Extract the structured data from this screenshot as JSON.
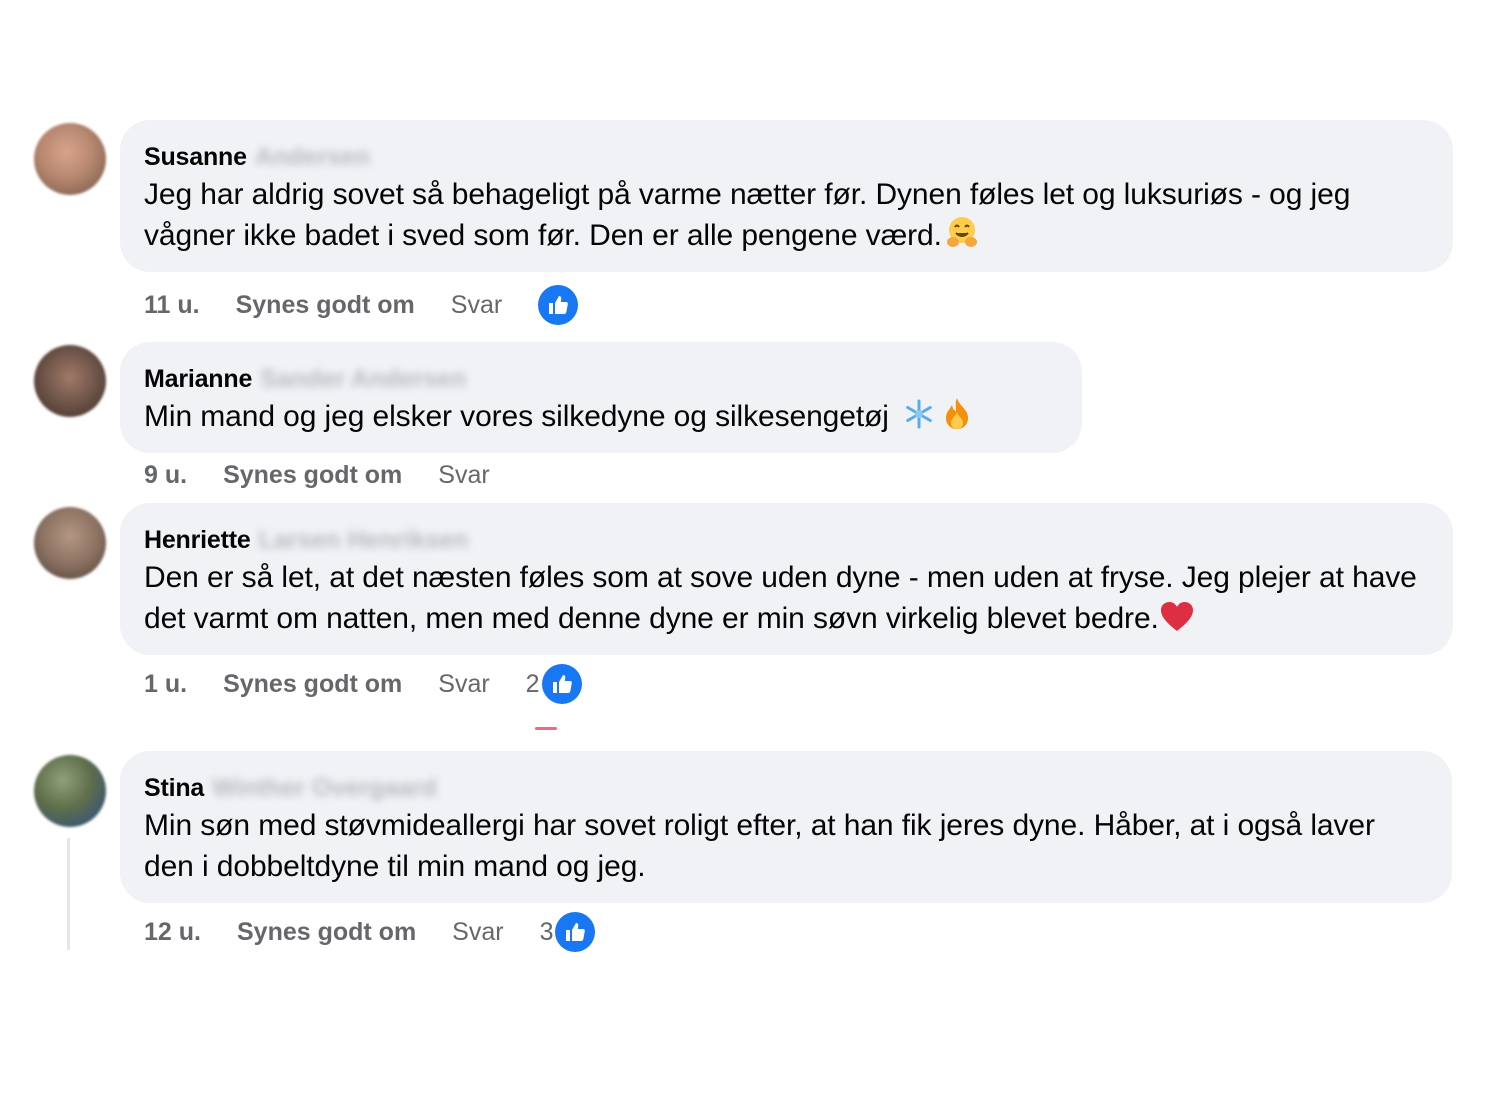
{
  "comments": [
    {
      "first_name": "Susanne",
      "last_name": "Andersen",
      "text": "Jeg har aldrig sovet så behageligt på varme nætter før. Dynen føles let og luksuriøs - og jeg vågner ikke badet i sved som før. Den er alle pengene værd.",
      "emoji": "smiling-face-with-open-hands",
      "time": "11 u.",
      "like_label": "Synes godt om",
      "reply_label": "Svar",
      "reaction_count": "",
      "avatar_color": "#b7876f"
    },
    {
      "first_name": "Marianne",
      "last_name": "Sander Andersen",
      "text": "Min mand og jeg elsker vores silkedyne og silkesengetøj",
      "emoji": "snowflake fire",
      "time": "9 u.",
      "like_label": "Synes godt om",
      "reply_label": "Svar",
      "reaction_count": "",
      "avatar_color": "#6e5448"
    },
    {
      "first_name": "Henriette",
      "last_name": "Larsen Henriksen",
      "text": "Den er så let, at det næsten føles som at sove uden dyne - men uden at fryse. Jeg plejer at have det varmt om natten, men med denne dyne er min søvn virkelig blevet bedre.",
      "emoji": "red-heart",
      "time": "1 u.",
      "like_label": "Synes godt om",
      "reply_label": "Svar",
      "reaction_count": "2",
      "avatar_color": "#8c7262"
    },
    {
      "first_name": "Stina",
      "last_name": "Winther Overgaard",
      "text": "Min søn med støvmideallergi har sovet roligt efter, at han fik jeres dyne. Håber, at i også laver den i dobbeltdyne til min mand og jeg.",
      "emoji": "",
      "time": "12 u.",
      "like_label": "Synes godt om",
      "reply_label": "Svar",
      "reaction_count": "3",
      "avatar_color": "#5f6e4a"
    }
  ],
  "colors": {
    "bubble_bg": "#f0f2f5",
    "like_blue": "#1877f2",
    "meta_gray": "#65676b"
  }
}
